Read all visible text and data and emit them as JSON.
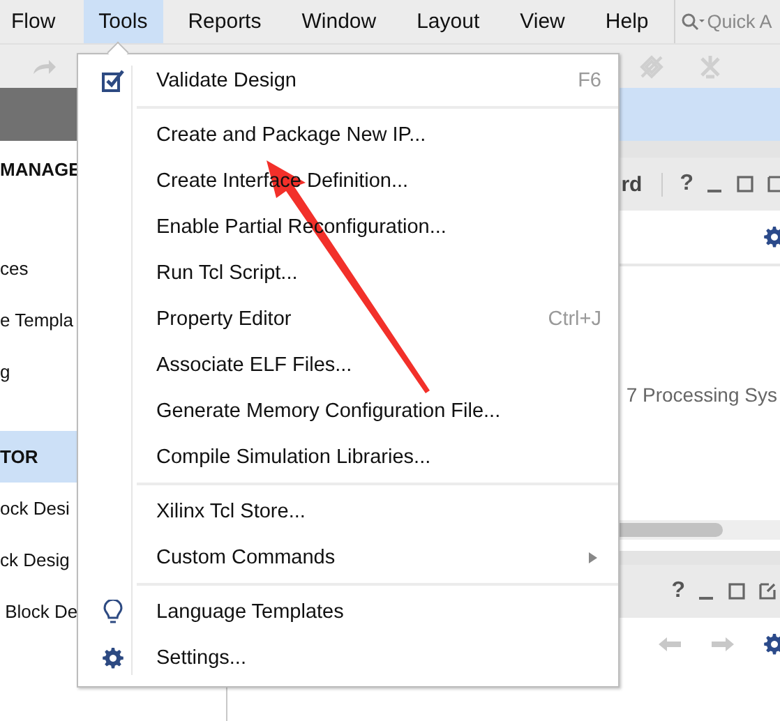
{
  "menubar": {
    "items": [
      {
        "label": "Flow",
        "selected": false
      },
      {
        "label": "Tools",
        "selected": true
      },
      {
        "label": "Reports",
        "selected": false
      },
      {
        "label": "Window",
        "selected": false
      },
      {
        "label": "Layout",
        "selected": false
      },
      {
        "label": "View",
        "selected": false
      },
      {
        "label": "Help",
        "selected": false
      }
    ],
    "search": {
      "placeholder": "Quick A"
    }
  },
  "left_panel": {
    "items": [
      {
        "text": "MANAGE",
        "bold": true,
        "selected": false
      },
      {
        "text": "ces",
        "bold": false,
        "selected": false
      },
      {
        "text": "e Templa",
        "bold": false,
        "selected": false
      },
      {
        "text": "g",
        "bold": false,
        "selected": false
      },
      {
        "text": "TOR",
        "bold": true,
        "selected": true
      },
      {
        "text": "ock Desi",
        "bold": false,
        "selected": false
      },
      {
        "text": "ck Desig",
        "bold": false,
        "selected": false
      },
      {
        "text": " Block De",
        "bold": false,
        "selected": false
      }
    ]
  },
  "right_panel": {
    "tab": "rd",
    "help": "?",
    "content": "7 Processing Sys",
    "bottom_help": "?"
  },
  "menu": {
    "sections": [
      [
        {
          "label": "Validate Design",
          "shortcut": "F6",
          "kind": "checkmark"
        }
      ],
      [
        {
          "label": "Create and Package New IP..."
        },
        {
          "label": "Create Interface Definition..."
        },
        {
          "label": "Enable Partial Reconfiguration..."
        },
        {
          "label": "Run Tcl Script..."
        },
        {
          "label": "Property Editor",
          "shortcut": "Ctrl+J"
        },
        {
          "label": "Associate ELF Files..."
        },
        {
          "label": "Generate Memory Configuration File..."
        },
        {
          "label": "Compile Simulation Libraries..."
        }
      ],
      [
        {
          "label": "Xilinx Tcl Store..."
        },
        {
          "label": "Custom Commands",
          "submenu": true
        }
      ],
      [
        {
          "label": "Language Templates",
          "kind": "bulb"
        },
        {
          "label": "Settings...",
          "kind": "gear"
        }
      ]
    ]
  }
}
